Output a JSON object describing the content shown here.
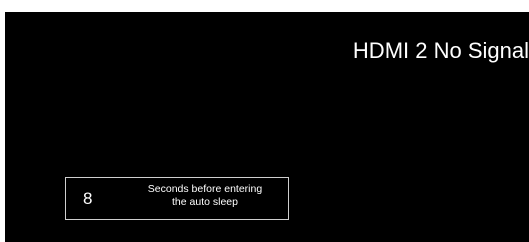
{
  "colors": {
    "background": "#000000",
    "text": "#ffffff",
    "box_border": "#cfcfcf"
  },
  "status": {
    "title": "HDMI 2 No Signal"
  },
  "sleep_notice": {
    "countdown": "8",
    "message_line1": "Seconds before entering",
    "message_line2": "the auto sleep"
  }
}
